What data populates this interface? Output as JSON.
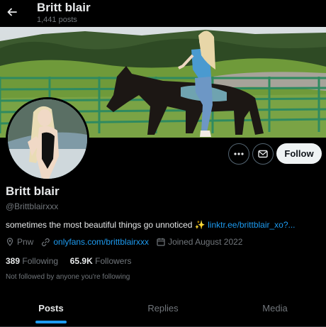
{
  "header": {
    "name": "Britt blair",
    "posts": "1,441 posts"
  },
  "actions": {
    "follow_label": "Follow"
  },
  "profile": {
    "name": "Britt blair",
    "handle": "@Brittblairxxx",
    "bio_text": "sometimes the most beautiful things go unnoticed",
    "bio_emoji": "✨",
    "bio_link": "linktr.ee/brittblair_xo?...",
    "location": "Pnw",
    "website": "onlyfans.com/brittblairxxx",
    "joined": "Joined August 2022",
    "following_count": "389",
    "following_label": "Following",
    "followers_count": "65.9K",
    "followers_label": "Followers",
    "not_followed": "Not followed by anyone you're following"
  },
  "tabs": [
    {
      "label": "Posts",
      "active": true
    },
    {
      "label": "Replies",
      "active": false
    },
    {
      "label": "Media",
      "active": false
    }
  ],
  "colors": {
    "accent": "#1d9bf0",
    "background": "#000000",
    "muted": "#71767b"
  },
  "icons": [
    "back-arrow-icon",
    "more-icon",
    "message-icon",
    "location-icon",
    "link-icon",
    "calendar-icon"
  ]
}
